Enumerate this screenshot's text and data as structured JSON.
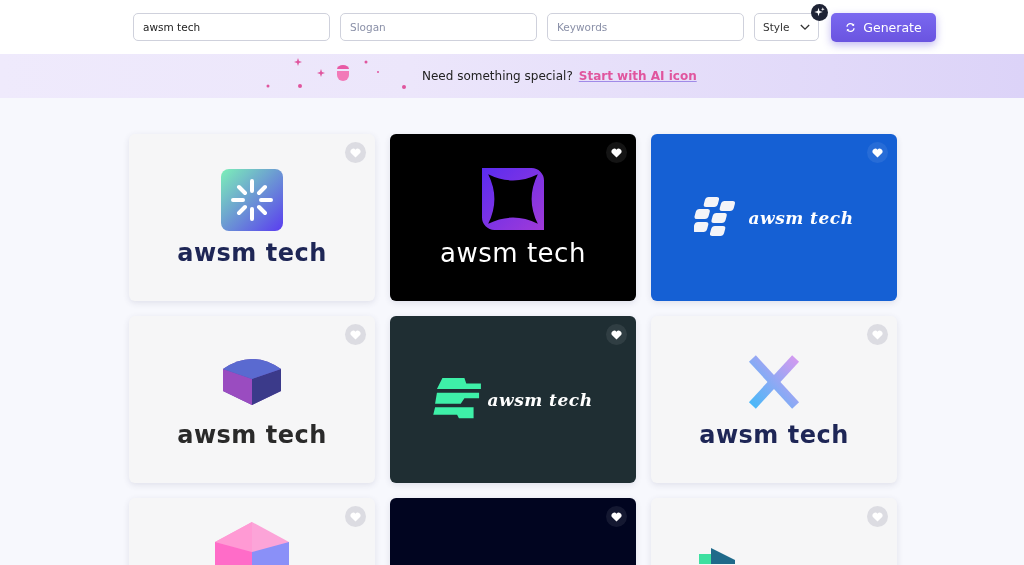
{
  "search": {
    "name_value": "awsm tech",
    "slogan_placeholder": "Slogan",
    "keywords_placeholder": "Keywords",
    "style_label": "Style",
    "generate_label": "Generate"
  },
  "banner": {
    "text": "Need something special?",
    "link": "Start with AI icon"
  },
  "logos": [
    {
      "color": "#f6f6f7",
      "kind": "spark",
      "wordmark": {
        "text": "awsm tech",
        "color": "#1e2656"
      },
      "favorite": false
    },
    {
      "color": "#000000",
      "kind": "star",
      "wordmark": {
        "text": "awsm tech",
        "color": "#ffffff"
      },
      "favorite": false
    },
    {
      "color": "#1560d4",
      "kind": "tiles",
      "wordmark": {
        "text": "awsm tech",
        "color": "#ffffff"
      },
      "favorite": false
    },
    {
      "color": "#f6f6f7",
      "kind": "cube",
      "wordmark": {
        "text": "awsm tech",
        "color": "#2a2a2a"
      },
      "favorite": false
    },
    {
      "color": "#1f2e33",
      "kind": "stairs",
      "wordmark": {
        "text": "awsm tech",
        "color": "#ffffff"
      },
      "favorite": false
    },
    {
      "color": "#f6f6f7",
      "kind": "cross",
      "wordmark": {
        "text": "awsm tech",
        "color": "#1e2656"
      },
      "favorite": false
    },
    {
      "color": "#f6f6f7",
      "kind": "gem",
      "favorite": false
    },
    {
      "color": "#010520",
      "kind": "blank",
      "favorite": false
    },
    {
      "color": "#f6f6f7",
      "kind": "arrow",
      "favorite": false
    }
  ]
}
